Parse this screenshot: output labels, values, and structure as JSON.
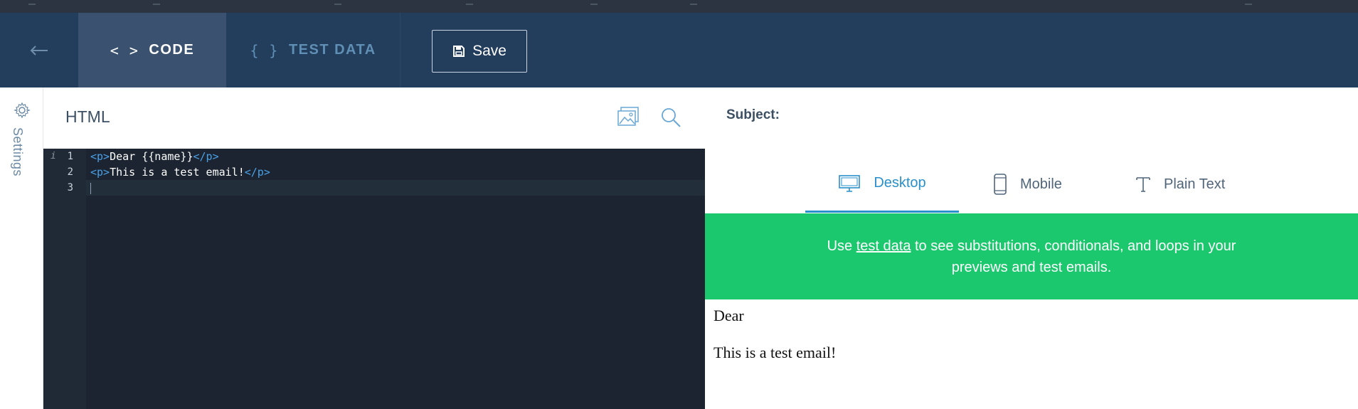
{
  "navbar": {
    "tabs": [
      {
        "glyph": "< >",
        "label": "CODE",
        "active": true
      },
      {
        "glyph": "{ }",
        "label": "TEST DATA",
        "active": false
      }
    ],
    "save_label": "Save"
  },
  "sidebar": {
    "settings_label": "Settings"
  },
  "editor": {
    "title": "HTML",
    "lines": [
      {
        "num": "1",
        "open": "<p>",
        "text": "Dear {{name}}",
        "close": "</p>"
      },
      {
        "num": "2",
        "open": "<p>",
        "text": "This is a test email!",
        "close": "</p>"
      },
      {
        "num": "3",
        "open": "",
        "text": "",
        "close": ""
      }
    ],
    "info_marker": "i"
  },
  "preview": {
    "subject_label": "Subject:",
    "view_tabs": [
      {
        "label": "Desktop",
        "icon": "monitor-icon",
        "active": true
      },
      {
        "label": "Mobile",
        "icon": "phone-icon",
        "active": false
      },
      {
        "label": "Plain Text",
        "icon": "text-icon",
        "active": false
      }
    ],
    "banner": {
      "before": "Use ",
      "link": "test data",
      "after": " to see substitutions, conditionals, and loops in your previews and test emails."
    },
    "body_lines": [
      "Dear",
      "This is a test email!"
    ]
  },
  "colors": {
    "navbar_bg": "#233d5d",
    "active_tab_bg": "#3a5270",
    "accent_blue": "#2a90cc",
    "banner_green": "#1bc86d",
    "editor_bg": "#1b2430",
    "tag_color": "#4aa0e6"
  }
}
